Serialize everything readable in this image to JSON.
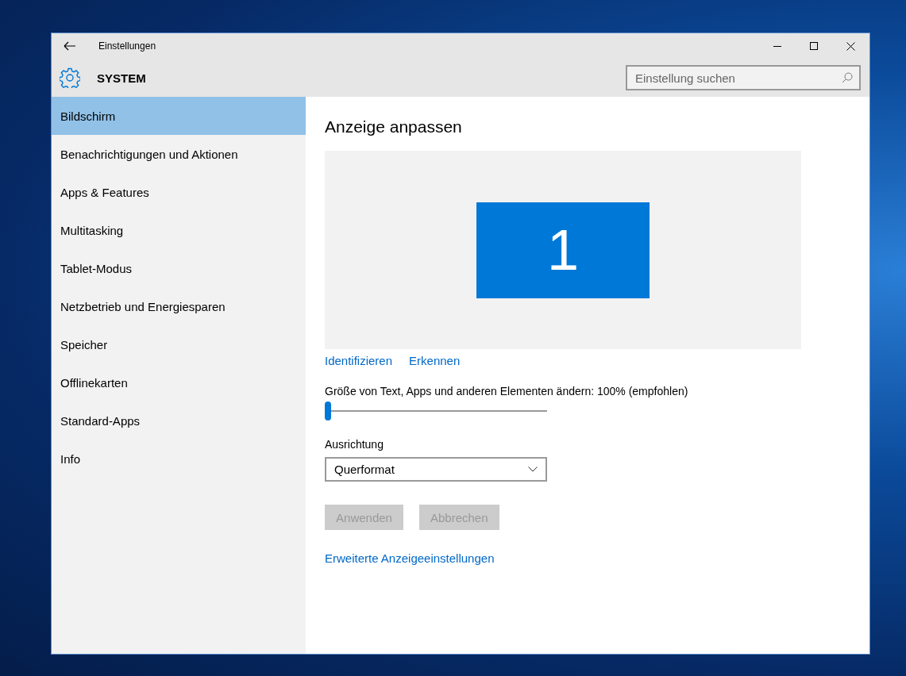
{
  "window": {
    "title": "Einstellungen"
  },
  "header": {
    "title": "SYSTEM",
    "search": {
      "placeholder": "Einstellung suchen"
    }
  },
  "sidebar": {
    "items": [
      {
        "label": "Bildschirm",
        "selected": true
      },
      {
        "label": "Benachrichtigungen und Aktionen",
        "selected": false
      },
      {
        "label": "Apps & Features",
        "selected": false
      },
      {
        "label": "Multitasking",
        "selected": false
      },
      {
        "label": "Tablet-Modus",
        "selected": false
      },
      {
        "label": "Netzbetrieb und Energiesparen",
        "selected": false
      },
      {
        "label": "Speicher",
        "selected": false
      },
      {
        "label": "Offlinekarten",
        "selected": false
      },
      {
        "label": "Standard-Apps",
        "selected": false
      },
      {
        "label": "Info",
        "selected": false
      }
    ]
  },
  "content": {
    "title": "Anzeige anpassen",
    "displays": [
      {
        "number": "1"
      }
    ],
    "links": [
      "Identifizieren",
      "Erkennen"
    ],
    "scale": {
      "label": "Größe von Text, Apps und anderen Elementen ändern: 100% (empfohlen)",
      "level": 0
    },
    "orientation": {
      "label": "Ausrichtung",
      "value": "Querformat"
    },
    "buttons": [
      {
        "label": "Anwenden",
        "disabled": true
      },
      {
        "label": "Abbrechen",
        "disabled": true
      }
    ],
    "advanced_link": "Erweiterte Anzeigeeinstellungen"
  }
}
